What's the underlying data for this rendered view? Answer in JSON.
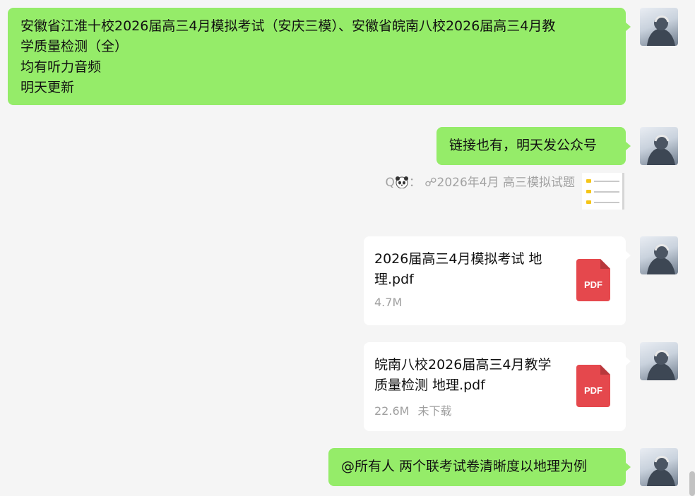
{
  "messages": {
    "msg1": {
      "lines": [
        "安徽省江淮十校2026届高三4月模拟考试（安庆三模）、安徽省皖南八校2026届高三4月教",
        "学质量检测（全）",
        "均有听力音频",
        "明天更新"
      ]
    },
    "msg2": {
      "text": "链接也有，明天发公众号"
    },
    "quote": {
      "prefix": "Q",
      "separator": "：",
      "link_symbol": "☍",
      "text": "2026年4月 高三模拟试题"
    },
    "file1": {
      "name": "2026届高三4月模拟考试 地理.pdf",
      "size": "4.7M",
      "status": ""
    },
    "file2": {
      "name": "皖南八校2026届高三4月教学质量检测 地理.pdf",
      "size": "22.6M",
      "status": "未下载"
    },
    "msg5": {
      "text": "@所有人 两个联考试卷清晰度以地理为例"
    }
  },
  "pdf_label": "PDF",
  "icons": [
    "avatar",
    "panda-emoji-icon",
    "link-icon",
    "pdf-icon",
    "folder-icon"
  ],
  "colors": {
    "bubble_green": "#95ec69",
    "background": "#f5f5f5",
    "pdf_red": "#e5484d",
    "meta_gray": "#a0a0a0"
  }
}
